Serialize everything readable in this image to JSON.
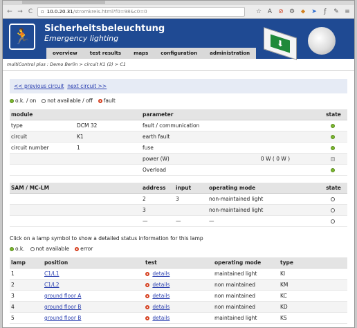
{
  "browser": {
    "url_host": "10.0.20.31",
    "url_path": "/stromkreis.html?f0=98&c0=0",
    "back": "←",
    "forward": "→",
    "reload": "C"
  },
  "header": {
    "title": "Sicherheitsbeleuchtung",
    "subtitle": "Emergency lighting"
  },
  "menu": [
    "overview",
    "test results",
    "maps",
    "configuration",
    "administration"
  ],
  "breadcrumb": "multiControl plus : Demo Berlin > circuit K1 (2) > C1",
  "nav": {
    "prev": "<< previous circuit",
    "next": "next circuit >>"
  },
  "legend1": {
    "ok": "o.k. / on",
    "na": "not available / off",
    "fault": "fault"
  },
  "module_table": {
    "headers": [
      "module",
      "",
      "parameter",
      "",
      "state"
    ],
    "rows": [
      {
        "label": "type",
        "value": "DCM 32",
        "param": "fault / communication",
        "pvalue": "",
        "state": "ok"
      },
      {
        "label": "circuit",
        "value": "K1",
        "param": "earth fault",
        "pvalue": "",
        "state": "ok"
      },
      {
        "label": "circuit number",
        "value": "1",
        "param": "fuse",
        "pvalue": "",
        "state": "ok"
      },
      {
        "label": "",
        "value": "",
        "param": "power (W)",
        "pvalue": "0 W ( 0 W )",
        "state": "grey"
      },
      {
        "label": "",
        "value": "",
        "param": "Overload",
        "pvalue": "",
        "state": "ok"
      }
    ]
  },
  "sam_table": {
    "headers": [
      "SAM / MC-LM",
      "address",
      "input",
      "operating mode",
      "state"
    ],
    "rows": [
      {
        "address": "2",
        "input": "3",
        "mode": "non-maintained light",
        "state": "na"
      },
      {
        "address": "3",
        "input": "",
        "mode": "non-maintained light",
        "state": "na"
      },
      {
        "address": "—",
        "input": "—",
        "mode": "—",
        "state": "na"
      }
    ]
  },
  "lamp_note": "Click on a lamp symbol to show a detailed status information for this lamp",
  "legend2": {
    "ok": "o.k.",
    "na": "not available",
    "error": "error"
  },
  "lamp_table": {
    "headers": [
      "lamp",
      "position",
      "test",
      "operating mode",
      "type"
    ],
    "rows": [
      {
        "lamp": "1",
        "position": "C1/L1",
        "test": "details",
        "mode": "maintained light",
        "type": "KI"
      },
      {
        "lamp": "2",
        "position": "C1/L2",
        "test": "details",
        "mode": "non maintained",
        "type": "KM"
      },
      {
        "lamp": "3",
        "position": "ground floor A",
        "test": "details",
        "mode": "non maintained",
        "type": "KC"
      },
      {
        "lamp": "4",
        "position": "ground floor B",
        "test": "details",
        "mode": "non maintained",
        "type": "KD"
      },
      {
        "lamp": "5",
        "position": "ground floor B",
        "test": "details",
        "mode": "maintained light",
        "type": "KS"
      }
    ]
  }
}
